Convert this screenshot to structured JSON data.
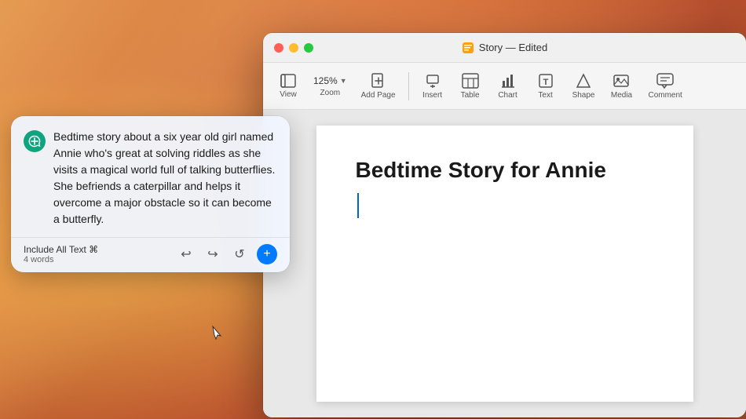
{
  "desktop": {
    "background": "macOS Monterey wallpaper"
  },
  "window": {
    "title": "Story — Edited",
    "app_icon": "📄",
    "traffic_lights": {
      "close": "close",
      "minimize": "minimize",
      "maximize": "maximize"
    }
  },
  "toolbar": {
    "view_label": "View",
    "zoom_value": "125%",
    "zoom_label": "Zoom",
    "add_page_label": "Add Page",
    "insert_label": "Insert",
    "table_label": "Table",
    "chart_label": "Chart",
    "text_label": "Text",
    "shape_label": "Shape",
    "media_label": "Media",
    "comment_label": "Comment"
  },
  "document": {
    "title": "Bedtime Story for Annie"
  },
  "ai_popup": {
    "message": "Bedtime story about a six year old girl named Annie who's great at solving riddles as she visits a magical world full of talking butterflies. She befriends a caterpillar and helps it overcome a major obstacle so it can become a butterfly.",
    "footer": {
      "include_text": "Include All Text ⌘",
      "word_count": "4 words"
    },
    "actions": {
      "undo": "↩",
      "redo": "↪",
      "refresh": "↺",
      "add": "+"
    }
  }
}
